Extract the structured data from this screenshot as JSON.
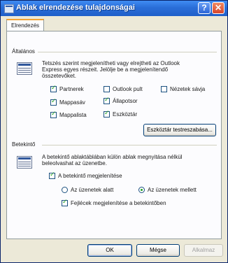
{
  "window": {
    "title": "Ablak elrendezése tulajdonságai",
    "help_label": "?",
    "close_label": "✕"
  },
  "tabs": [
    {
      "label": "Elrendezés"
    }
  ],
  "general": {
    "label": "Általános",
    "desc_lines": [
      "Tetszés szerint megjelenítheti vagy elrejtheti az Outlook",
      "Express egyes részeit. Jelölje be a megjelenítendő",
      "összetevőket."
    ],
    "checkboxes": [
      {
        "label": "Partnerek",
        "checked": true
      },
      {
        "label": "Outlook pult",
        "checked": false
      },
      {
        "label": "Nézetek sávja",
        "checked": false
      },
      {
        "label": "Mappasáv",
        "checked": true
      },
      {
        "label": "Állapotsor",
        "checked": true
      },
      {
        "label": "Mappalista",
        "checked": true
      },
      {
        "label": "Eszköztár",
        "checked": true
      }
    ],
    "customize_button": "Eszköztár testreszabása..."
  },
  "preview": {
    "label": "Betekintő",
    "desc_lines": [
      "A betekintő ablaktáblában külön ablak megnyitása nélkül",
      "beleolvashat az üzenetbe."
    ],
    "show_preview": {
      "label": "A betekintő megjelenítése",
      "checked": true
    },
    "radios": [
      {
        "label": "Az üzenetek alatt",
        "checked": false
      },
      {
        "label": "Az üzenetek mellett",
        "checked": true
      }
    ],
    "show_headers": {
      "label": "Fejlécek megjelenítése a betekintőben",
      "checked": true
    }
  },
  "buttons": {
    "ok": "OK",
    "cancel": "Mégse",
    "apply": "Alkalmaz"
  }
}
